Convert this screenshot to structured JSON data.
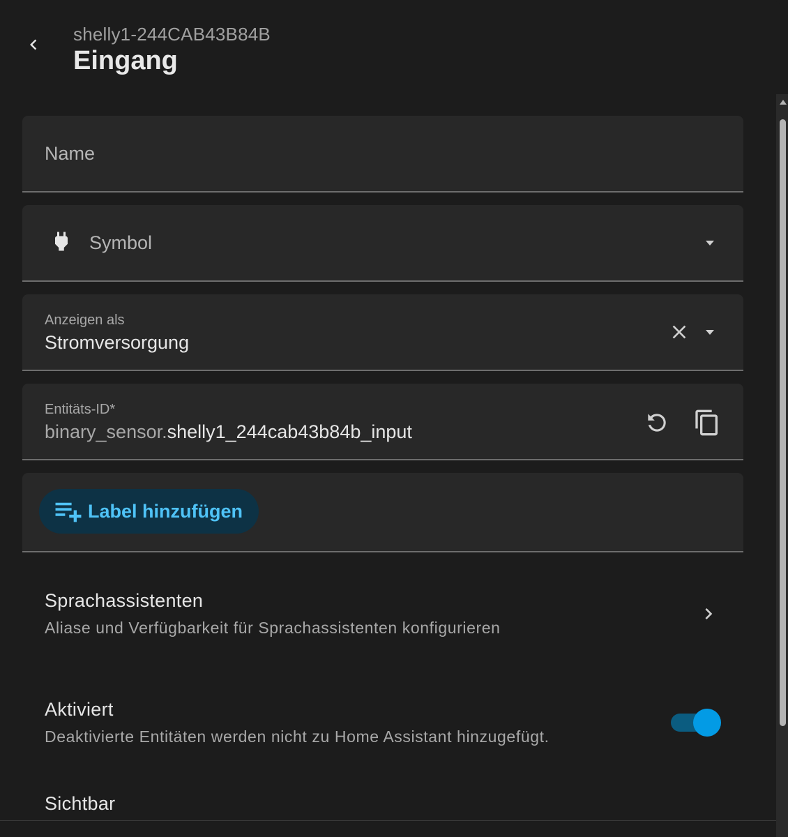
{
  "header": {
    "subtitle": "shelly1-244CAB43B84B",
    "title": "Eingang",
    "back_icon": "chevron-left-icon"
  },
  "fields": {
    "name": {
      "label": "Name",
      "value": ""
    },
    "symbol": {
      "label": "Symbol",
      "icon": "power-plug-icon"
    },
    "display_as": {
      "label": "Anzeigen als",
      "value": "Stromversorgung"
    },
    "entity_id": {
      "label": "Entitäts-ID*",
      "prefix": "binary_sensor.",
      "value": "shelly1_244cab43b84b_input"
    }
  },
  "labels": {
    "add_label": "Label hinzufügen"
  },
  "voice_assistants": {
    "title": "Sprachassistenten",
    "description": "Aliase und Verfügbarkeit für Sprachassistenten konfigurieren"
  },
  "enabled": {
    "title": "Aktiviert",
    "description": "Deaktivierte Entitäten werden nicht zu Home Assistant hinzugefügt.",
    "on": true
  },
  "visible": {
    "title": "Sichtbar"
  },
  "colors": {
    "background": "#1c1c1c",
    "field_bg": "#282828",
    "accent": "#039be5",
    "label_button_text": "#4fc3f7"
  }
}
